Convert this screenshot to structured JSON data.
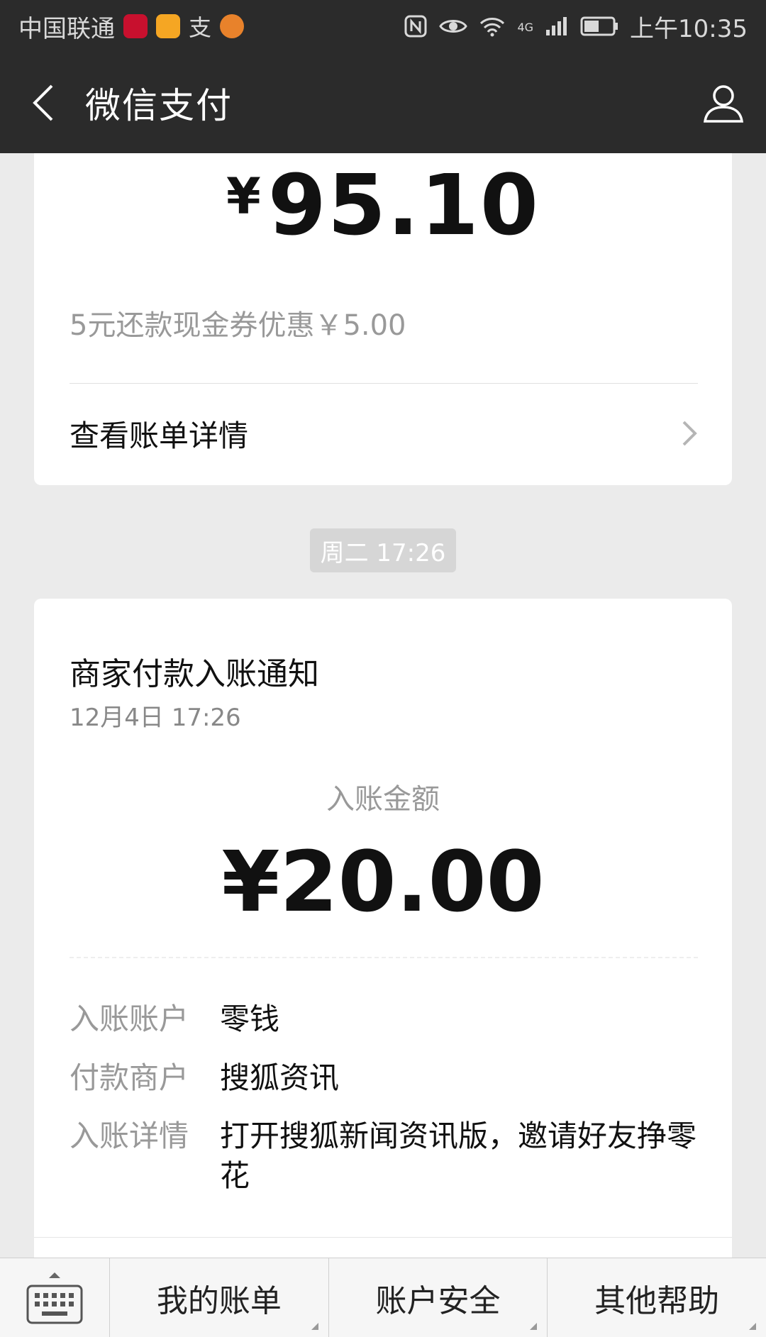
{
  "status_bar": {
    "carrier": "中国联通",
    "time": "上午10:35",
    "network": "4G"
  },
  "nav": {
    "title": "微信支付"
  },
  "card1": {
    "amount_currency": "¥",
    "amount_value": "95.10",
    "coupon_text": "5元还款现金券优惠￥5.00",
    "detail_link": "查看账单详情"
  },
  "time_badge": "周二 17:26",
  "notice": {
    "title": "商家付款入账通知",
    "date": "12月4日  17:26",
    "amount_label": "入账金额",
    "amount": "¥20.00",
    "rows": [
      {
        "key": "入账账户",
        "value": "零钱"
      },
      {
        "key": "付款商户",
        "value": "搜狐资讯"
      },
      {
        "key": "入账详情",
        "value": "打开搜狐新闻资讯版，邀请好友挣零花"
      }
    ]
  },
  "tabs": [
    "我的账单",
    "账户安全",
    "其他帮助"
  ],
  "colors": {
    "header_bg": "#2b2b2b",
    "page_bg": "#ebebeb",
    "card_bg": "#ffffff",
    "muted_text": "#999999"
  },
  "icons": {
    "back": "chevron-left-icon",
    "user": "user-icon",
    "chevron": "chevron-right-icon",
    "keyboard": "keyboard-icon"
  }
}
